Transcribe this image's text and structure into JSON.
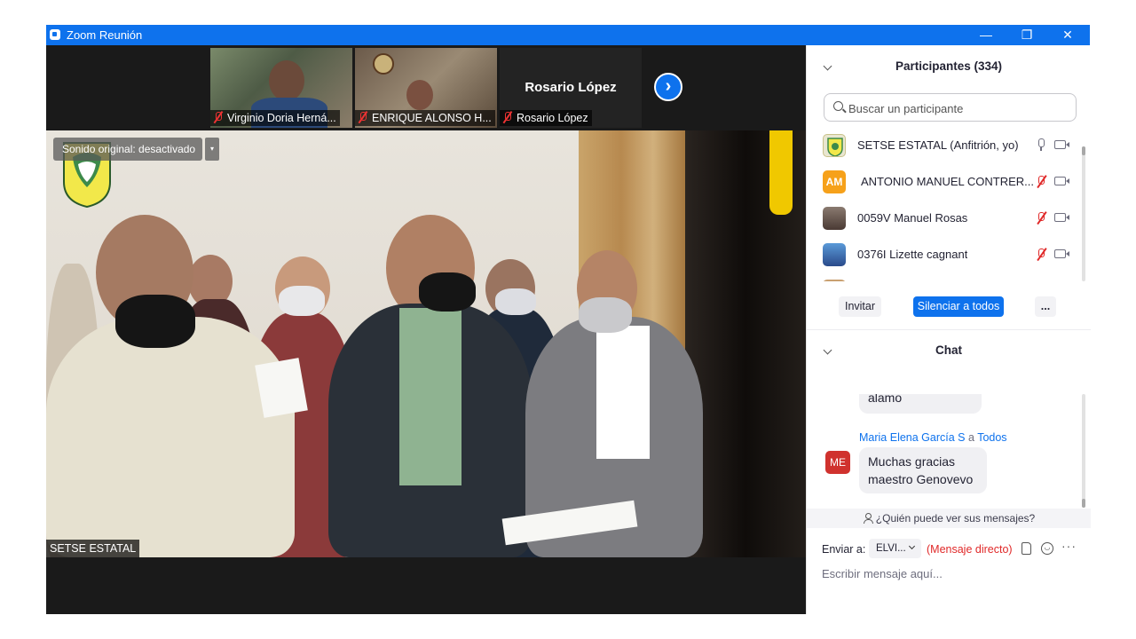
{
  "window": {
    "title": "Zoom Reunión",
    "minimize_glyph": "—",
    "restore_glyph": "❐",
    "close_glyph": "✕"
  },
  "thumbnails": [
    {
      "name": "Virginio Doria Herná...",
      "muted": true
    },
    {
      "name": "ENRIQUE ALONSO H...",
      "muted": true
    },
    {
      "name": "Rosario López",
      "muted": true,
      "display_name_center": "Rosario López"
    }
  ],
  "next_button_glyph": "›",
  "main_video": {
    "original_sound": "Sonido original: desactivado",
    "dropdown_glyph": "▾",
    "speaker_label": "SETSE ESTATAL"
  },
  "participants": {
    "header": "Participantes (334)",
    "search_placeholder": "Buscar un participante",
    "items": [
      {
        "name": "SETSE ESTATAL (Anfitrión, yo)",
        "initials": "",
        "avatar_color": "#e9e6d0",
        "mic": "on"
      },
      {
        "name": "ANTONIO MANUEL CONTRER...",
        "initials": "AM",
        "avatar_color": "#f6a11a",
        "mic": "off"
      },
      {
        "name": "0059V Manuel Rosas",
        "initials": "",
        "avatar_color": "#7a6a62",
        "mic": "off"
      },
      {
        "name": "0376I Lizette cagnant",
        "initials": "",
        "avatar_color": "#3a6fa8",
        "mic": "off"
      }
    ],
    "invite_label": "Invitar",
    "mute_all_label": "Silenciar a todos",
    "more_label": "..."
  },
  "chat": {
    "header": "Chat",
    "previous_message": "alamo",
    "sender": "Maria Elena García S",
    "to_word": "a",
    "recipient": "Todos",
    "sender_initials": "ME",
    "message_line1": "Muchas gracias",
    "message_line2": "maestro Genovevo",
    "who_can_see": "¿Quién puede ver sus mensajes?",
    "send_to_label": "Enviar a:",
    "send_to_value": "ELVI...",
    "direct_message": "(Mensaje directo)",
    "input_placeholder": "Escribir mensaje aquí...",
    "more_glyph": "···"
  }
}
